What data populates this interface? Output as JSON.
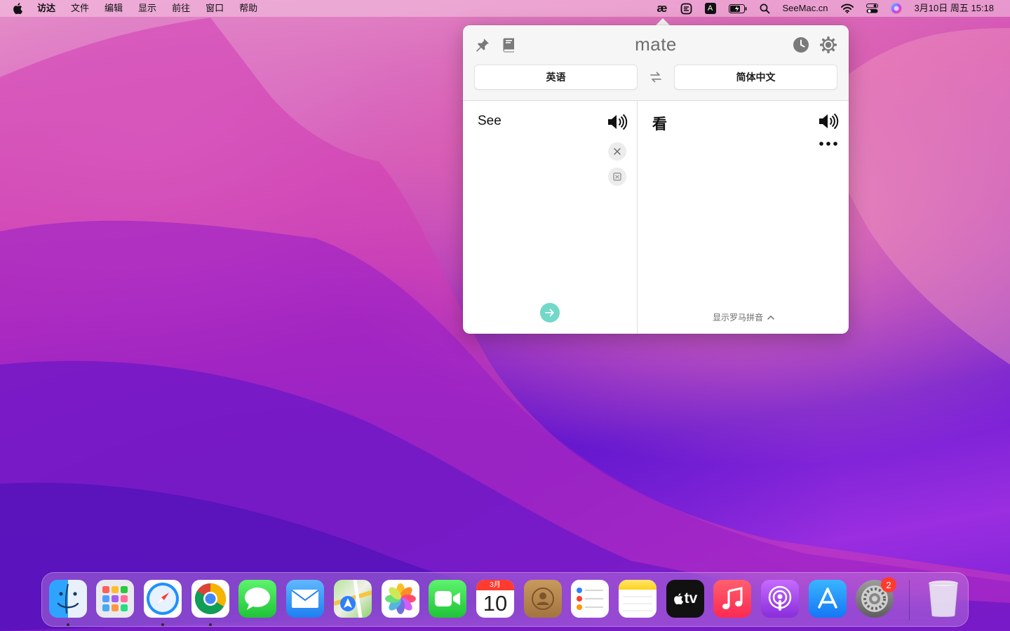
{
  "menubar": {
    "items": [
      "访达",
      "文件",
      "编辑",
      "显示",
      "前往",
      "窗口",
      "帮助"
    ],
    "status": {
      "brand": "SeeMac.cn",
      "input_label": "A",
      "ae_label": "æ",
      "datetime": "3月10日 周五  15:18"
    }
  },
  "translator": {
    "title": "mate",
    "source_lang": "英语",
    "target_lang": "简体中文",
    "source_text": "See",
    "target_text": "看",
    "romaji_toggle": "显示罗马拼音"
  },
  "dock": {
    "items": [
      "访达",
      "启动台",
      "Safari浏览器",
      "Google Chrome",
      "信息",
      "邮件",
      "地图",
      "照片",
      "FaceTime通话",
      "日历",
      "通讯录",
      "提醒事项",
      "备忘录",
      "视频",
      "音乐",
      "播客",
      "App Store",
      "系统偏好设置",
      "废纸篓"
    ],
    "calendar_month": "3月",
    "calendar_day": "10",
    "tv_label": "tv",
    "settings_badge": "2"
  },
  "colors": {
    "accent_go": "#72d8c8",
    "badge": "#ff3b30"
  }
}
